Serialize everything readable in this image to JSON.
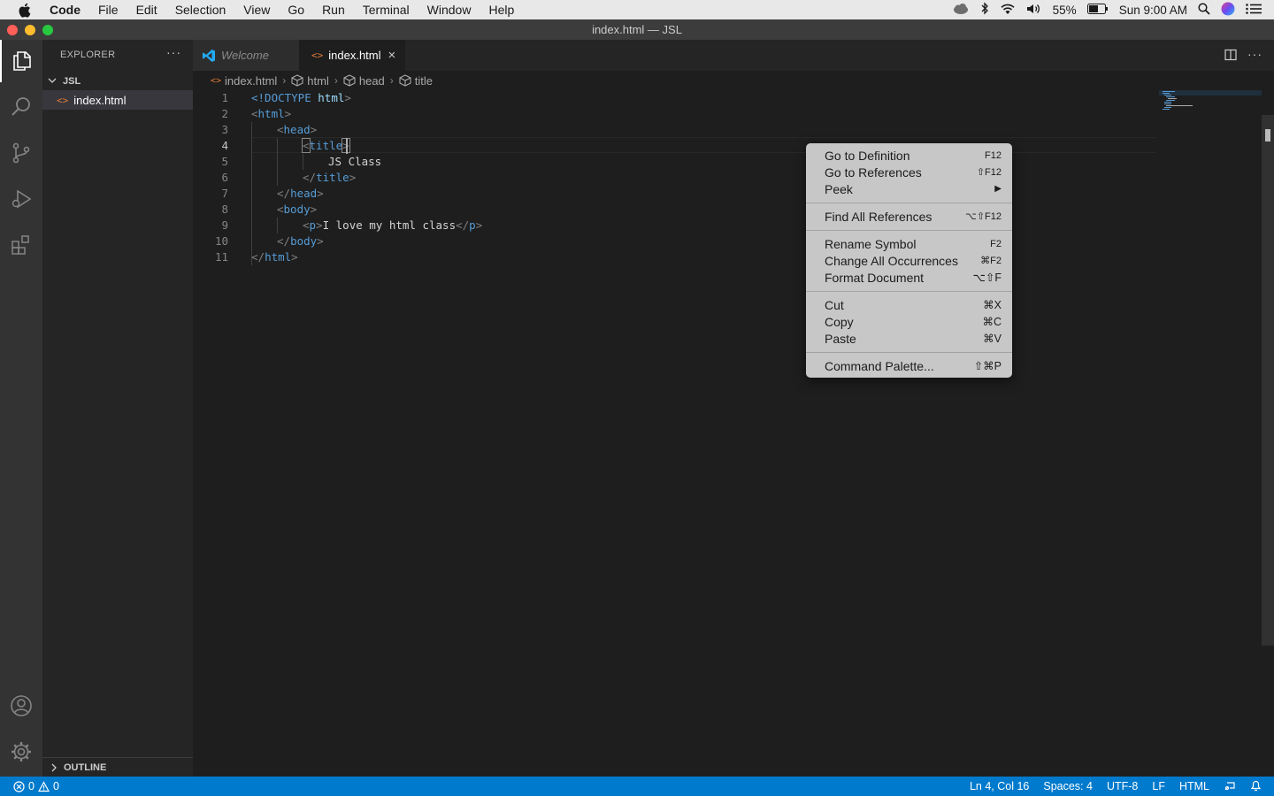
{
  "menubar": {
    "app_name": "Code",
    "items": [
      "File",
      "Edit",
      "Selection",
      "View",
      "Go",
      "Run",
      "Terminal",
      "Window",
      "Help"
    ],
    "battery": "55%",
    "clock": "Sun 9:00 AM"
  },
  "window": {
    "title": "index.html — JSL"
  },
  "explorer": {
    "title": "EXPLORER",
    "more": "···",
    "folder": "JSL",
    "file": "index.html",
    "outline": "OUTLINE"
  },
  "tabs": [
    {
      "label": "Welcome"
    },
    {
      "label": "index.html",
      "close": "×"
    }
  ],
  "breadcrumb": [
    "index.html",
    "html",
    "head",
    "title"
  ],
  "editor": {
    "line_numbers": [
      "1",
      "2",
      "3",
      "4",
      "5",
      "6",
      "7",
      "8",
      "9",
      "10",
      "11"
    ],
    "current_line": "4",
    "lines": [
      {
        "pre": "<!DOCTYPE ",
        "tag": "html",
        "post": ">"
      },
      {
        "pre": "<",
        "tag": "html",
        "post": ">"
      },
      {
        "pre": "<",
        "tag": "head",
        "post": ">"
      },
      {
        "pre": "<",
        "tag": "title",
        "post": ">"
      },
      {
        "text": "JS Class"
      },
      {
        "pre": "</",
        "tag": "title",
        "post": ">"
      },
      {
        "pre": "</",
        "tag": "head",
        "post": ">"
      },
      {
        "pre": "<",
        "tag": "body",
        "post": ">"
      },
      {
        "pre": "<",
        "tag": "p",
        "post": ">",
        "text": "I love my html class",
        "close_pre": "</",
        "close_tag": "p",
        "close_post": ">"
      },
      {
        "pre": "</",
        "tag": "body",
        "post": ">"
      },
      {
        "pre": "</",
        "tag": "html",
        "post": ">"
      }
    ]
  },
  "context_menu": {
    "items": [
      {
        "label": "Go to Definition",
        "shortcut": "F12"
      },
      {
        "label": "Go to References",
        "shortcut": "⇧F12"
      },
      {
        "label": "Peek",
        "shortcut": "▶"
      },
      {
        "label": "Find All References",
        "shortcut": "⌥⇧F12"
      },
      {
        "label": "Rename Symbol",
        "shortcut": "F2"
      },
      {
        "label": "Change All Occurrences",
        "shortcut": "⌘F2"
      },
      {
        "label": "Format Document",
        "shortcut": "⌥⇧F"
      },
      {
        "label": "Cut",
        "shortcut": "⌘X"
      },
      {
        "label": "Copy",
        "shortcut": "⌘C"
      },
      {
        "label": "Paste",
        "shortcut": "⌘V"
      },
      {
        "label": "Command Palette...",
        "shortcut": "⇧⌘P"
      }
    ]
  },
  "statusbar": {
    "errors": "0",
    "warnings": "0",
    "position": "Ln 4, Col 16",
    "spaces": "Spaces: 4",
    "encoding": "UTF-8",
    "eol": "LF",
    "language": "HTML"
  },
  "colors": {
    "accent": "#007acc",
    "tag": "#569cd6",
    "file_icon": "#e37933",
    "vscode_blue": "#23a9f2"
  }
}
